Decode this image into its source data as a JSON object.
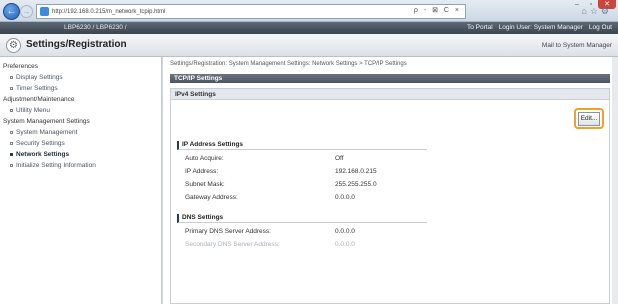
{
  "browser": {
    "url": "http://192.168.0.215/m_network_tcpip.html",
    "addr_tools": "ρ - ⊠ C ×"
  },
  "header": {
    "model": "LBP6230 / LBP6230 /",
    "to_portal": "To Portal",
    "login_user": "Login User: System Manager",
    "log_out": "Log Out"
  },
  "title": {
    "text": "Settings/Registration",
    "mail": "Mail to System Manager"
  },
  "sidebar": {
    "sections": [
      {
        "label": "Preferences"
      },
      {
        "label": "Adjustment/Maintenance"
      },
      {
        "label": "System Management Settings"
      }
    ],
    "items": [
      {
        "label": "Display Settings"
      },
      {
        "label": "Timer Settings"
      },
      {
        "label": "Utility Menu"
      },
      {
        "label": "System Management"
      },
      {
        "label": "Security Settings"
      },
      {
        "label": "Network Settings"
      },
      {
        "label": "Initialize Setting Information"
      }
    ]
  },
  "main": {
    "breadcrumb": "Settings/Registration: System Management Settings: Network Settings > TCP/IP Settings",
    "section_title": "TCP/IP Settings",
    "panel_title": "IPv4 Settings",
    "edit_label": "Edit...",
    "ip_group": "IP Address Settings",
    "ip_rows": [
      {
        "label": "Auto Acquire:",
        "value": "Off"
      },
      {
        "label": "IP Address:",
        "value": "192.168.0.215"
      },
      {
        "label": "Subnet Mask:",
        "value": "255.255.255.0"
      },
      {
        "label": "Gateway Address:",
        "value": "0.0.0.0"
      }
    ],
    "dns_group": "DNS Settings",
    "dns_rows": [
      {
        "label": "Primary DNS Server Address:",
        "value": "0.0.0.0"
      },
      {
        "label": "Secondary DNS Server Address:",
        "value": "0.0.0.0"
      }
    ]
  }
}
